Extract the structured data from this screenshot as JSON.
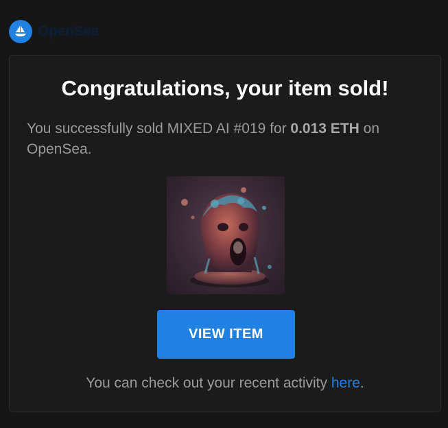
{
  "header": {
    "logo_text": "OpenSea",
    "logo_icon": "opensea-boat-icon"
  },
  "card": {
    "title": "Congratulations, your item sold!",
    "message_prefix": "You successfully sold MIXED AI #019 for ",
    "price": "0.013 ETH",
    "message_suffix": " on OpenSea.",
    "image_icon": "screaming-sculpture-nft-image",
    "view_button_label": "VIEW ITEM",
    "footer_prefix": "You can check out your recent activity ",
    "footer_link": "here",
    "footer_suffix": "."
  },
  "colors": {
    "background": "#161616",
    "card": "#1b1b1b",
    "accent": "#2081e2",
    "muted_text": "#9b9b9b"
  }
}
